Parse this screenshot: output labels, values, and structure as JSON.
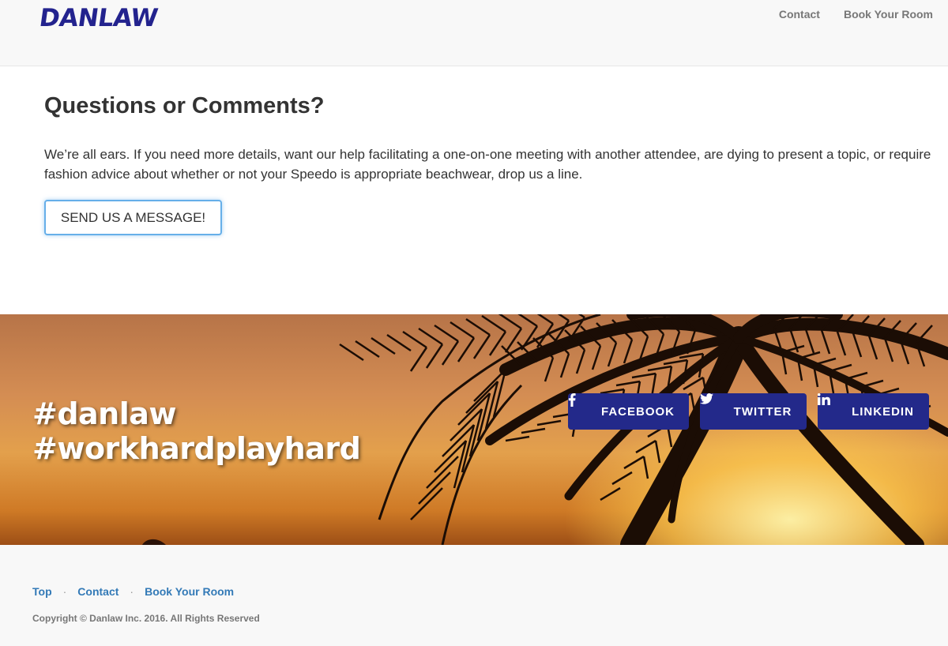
{
  "brand": {
    "logo_text": "DANLAW",
    "color": "#23238e"
  },
  "nav": {
    "items": [
      "Contact",
      "Book Your Room"
    ]
  },
  "contact_section": {
    "heading": "Questions or Comments?",
    "paragraph": "We’re all ears. If you need more details, want our help facilitating a one-on-one meeting with another attendee, are dying to present a topic, or require fashion advice about whether or not your Speedo is appropriate beachwear, drop us a line.",
    "button_label": "SEND US A MESSAGE!"
  },
  "banner": {
    "hashtags": [
      "#danlaw",
      "#workhardplayhard"
    ],
    "social_buttons": [
      {
        "label": "FACEBOOK",
        "icon": "facebook-icon"
      },
      {
        "label": "TWITTER",
        "icon": "twitter-icon"
      },
      {
        "label": "LINKEDIN",
        "icon": "linkedin-icon"
      }
    ],
    "button_color": "#23298a"
  },
  "footer": {
    "links": [
      "Top",
      "Contact",
      "Book Your Room"
    ],
    "separator": "·",
    "copyright": "Copyright © Danlaw Inc. 2016. All Rights Reserved",
    "link_color": "#337ab7"
  }
}
